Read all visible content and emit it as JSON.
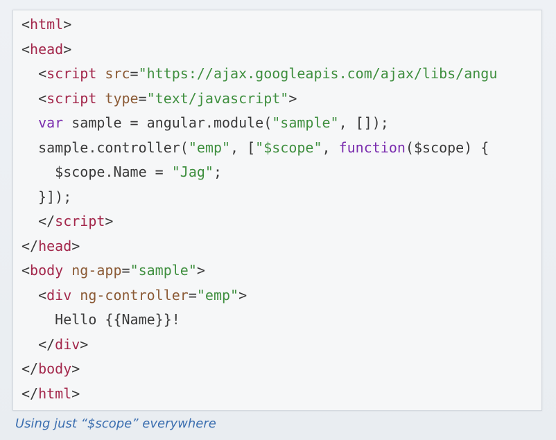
{
  "code_lines": [
    [
      {
        "text": "<",
        "kind": "punct"
      },
      {
        "text": "html",
        "kind": "tag"
      },
      {
        "text": ">",
        "kind": "punct"
      }
    ],
    [
      {
        "text": "<",
        "kind": "punct"
      },
      {
        "text": "head",
        "kind": "tag"
      },
      {
        "text": ">",
        "kind": "punct"
      }
    ],
    [
      {
        "text": "  <",
        "kind": "punct"
      },
      {
        "text": "script",
        "kind": "tag"
      },
      {
        "text": " ",
        "kind": "plain"
      },
      {
        "text": "src",
        "kind": "attr"
      },
      {
        "text": "=",
        "kind": "punct"
      },
      {
        "text": "\"https://ajax.googleapis.com/ajax/libs/angu",
        "kind": "string"
      }
    ],
    [
      {
        "text": "  <",
        "kind": "punct"
      },
      {
        "text": "script",
        "kind": "tag"
      },
      {
        "text": " ",
        "kind": "plain"
      },
      {
        "text": "type",
        "kind": "attr"
      },
      {
        "text": "=",
        "kind": "punct"
      },
      {
        "text": "\"text/javascript\"",
        "kind": "string"
      },
      {
        "text": ">",
        "kind": "punct"
      }
    ],
    [
      {
        "text": "  ",
        "kind": "plain"
      },
      {
        "text": "var",
        "kind": "keyword"
      },
      {
        "text": " sample = angular.module(",
        "kind": "plain"
      },
      {
        "text": "\"sample\"",
        "kind": "string"
      },
      {
        "text": ", []);",
        "kind": "plain"
      }
    ],
    [
      {
        "text": "  sample.controller(",
        "kind": "plain"
      },
      {
        "text": "\"emp\"",
        "kind": "string"
      },
      {
        "text": ", [",
        "kind": "plain"
      },
      {
        "text": "\"$scope\"",
        "kind": "string"
      },
      {
        "text": ", ",
        "kind": "plain"
      },
      {
        "text": "function",
        "kind": "keyword"
      },
      {
        "text": "($scope) {",
        "kind": "plain"
      }
    ],
    [
      {
        "text": "    $scope.Name = ",
        "kind": "plain"
      },
      {
        "text": "\"Jag\"",
        "kind": "string"
      },
      {
        "text": ";",
        "kind": "plain"
      }
    ],
    [
      {
        "text": "  }]);",
        "kind": "plain"
      }
    ],
    [
      {
        "text": "  </",
        "kind": "punct"
      },
      {
        "text": "script",
        "kind": "tag"
      },
      {
        "text": ">",
        "kind": "punct"
      }
    ],
    [
      {
        "text": "</",
        "kind": "punct"
      },
      {
        "text": "head",
        "kind": "tag"
      },
      {
        "text": ">",
        "kind": "punct"
      }
    ],
    [
      {
        "text": "<",
        "kind": "punct"
      },
      {
        "text": "body",
        "kind": "tag"
      },
      {
        "text": " ",
        "kind": "plain"
      },
      {
        "text": "ng-app",
        "kind": "attr"
      },
      {
        "text": "=",
        "kind": "punct"
      },
      {
        "text": "\"sample\"",
        "kind": "string"
      },
      {
        "text": ">",
        "kind": "punct"
      }
    ],
    [
      {
        "text": "  <",
        "kind": "punct"
      },
      {
        "text": "div",
        "kind": "tag"
      },
      {
        "text": " ",
        "kind": "plain"
      },
      {
        "text": "ng-controller",
        "kind": "attr"
      },
      {
        "text": "=",
        "kind": "punct"
      },
      {
        "text": "\"emp\"",
        "kind": "string"
      },
      {
        "text": ">",
        "kind": "punct"
      }
    ],
    [
      {
        "text": "    Hello {{Name}}!",
        "kind": "plain"
      }
    ],
    [
      {
        "text": "  </",
        "kind": "punct"
      },
      {
        "text": "div",
        "kind": "tag"
      },
      {
        "text": ">",
        "kind": "punct"
      }
    ],
    [
      {
        "text": "</",
        "kind": "punct"
      },
      {
        "text": "body",
        "kind": "tag"
      },
      {
        "text": ">",
        "kind": "punct"
      }
    ],
    [
      {
        "text": "</",
        "kind": "punct"
      },
      {
        "text": "html",
        "kind": "tag"
      },
      {
        "text": ">",
        "kind": "punct"
      }
    ]
  ],
  "caption": "Using just “$scope” everywhere",
  "colors": {
    "tag": "#a3274b",
    "attr": "#8b5a35",
    "string": "#3f8f3f",
    "keyword": "#7a2cae",
    "plain": "#3a3a3a",
    "caption": "#3c6fb0"
  }
}
